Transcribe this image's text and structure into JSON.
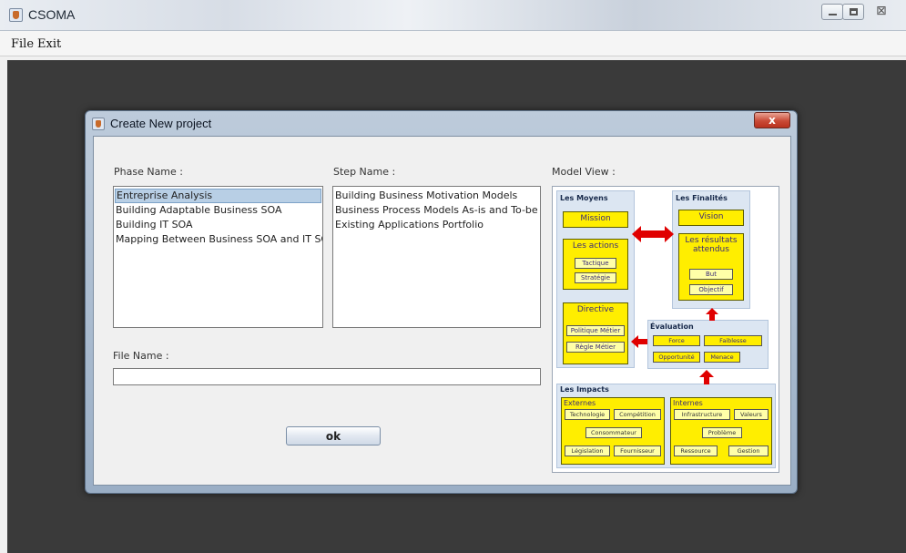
{
  "window": {
    "title": "CSOMA"
  },
  "menubar": {
    "file": "File",
    "exit": "Exit"
  },
  "dialog": {
    "title": "Create New project",
    "phase_label": "Phase Name :",
    "step_label": "Step Name :",
    "model_label": "Model View :",
    "filename_label": "File Name :",
    "filename_value": "",
    "ok_label": "ok",
    "phases": [
      "Entreprise Analysis",
      "Building Adaptable Business SOA",
      "Building IT SOA",
      "Mapping Between Business SOA and IT SOA"
    ],
    "selected_phase_index": 0,
    "steps": [
      "Building Business Motivation Models",
      "Business Process Models As-is and To-be",
      "Existing Applications Portfolio"
    ]
  },
  "model_view": {
    "moyens": {
      "heading": "Les Moyens",
      "mission": "Mission",
      "actions": {
        "title": "Les actions",
        "items": [
          "Tactique",
          "Stratégie"
        ]
      },
      "directive": {
        "title": "Directive",
        "items": [
          "Politique Métier",
          "Règle Métier"
        ]
      }
    },
    "finalites": {
      "heading": "Les Finalités",
      "vision": "Vision",
      "resultats": {
        "title": "Les résultats attendus",
        "items": [
          "But",
          "Objectif"
        ]
      }
    },
    "evaluation": {
      "heading": "Évaluation",
      "items": [
        "Force",
        "Faiblesse",
        "Opportunité",
        "Menace"
      ]
    },
    "impacts": {
      "heading": "Les Impacts",
      "externes": {
        "title": "Externes",
        "items": [
          "Technologie",
          "Compétition",
          "Consommateur",
          "Législation",
          "Fournisseur"
        ]
      },
      "internes": {
        "title": "Internes",
        "items": [
          "Infrastructure",
          "Valeurs",
          "Problème",
          "Ressource",
          "Gestion"
        ]
      }
    },
    "colors": {
      "box": "#ffee00",
      "arrow": "#e00000",
      "panel": "#dce6f2"
    }
  }
}
